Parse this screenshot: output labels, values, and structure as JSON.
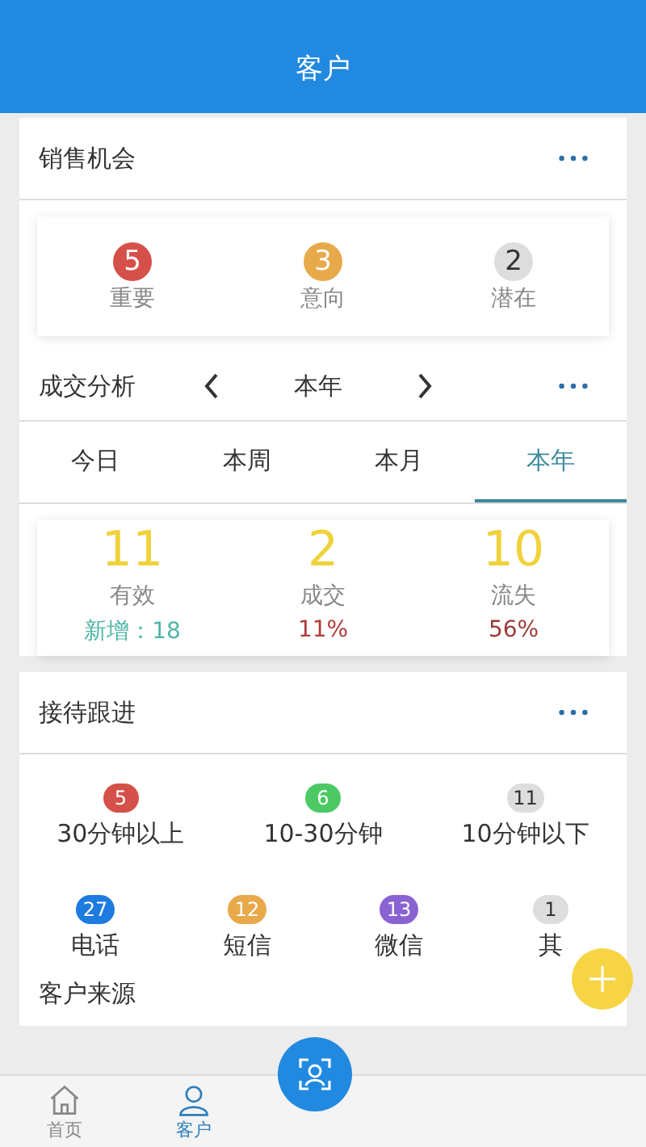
{
  "header": {
    "title": "客户"
  },
  "sales": {
    "title": "销售机会",
    "items": [
      {
        "count": "5",
        "label": "重要",
        "color": "#d6504a"
      },
      {
        "count": "3",
        "label": "意向",
        "color": "#e8a94a"
      },
      {
        "count": "2",
        "label": "潜在",
        "color": "#dddddd"
      }
    ]
  },
  "analysis": {
    "title": "成交分析",
    "period": "本年",
    "tabs": [
      {
        "label": "今日",
        "selected": false
      },
      {
        "label": "本周",
        "selected": false
      },
      {
        "label": "本月",
        "selected": false
      },
      {
        "label": "本年",
        "selected": true
      }
    ],
    "stats": [
      {
        "value": "11",
        "label": "有效",
        "sub": "新增：18",
        "color": "#4db6a8"
      },
      {
        "value": "2",
        "label": "成交",
        "sub": "11%",
        "color": "#b23a3a"
      },
      {
        "value": "10",
        "label": "流失",
        "sub": "56%",
        "color": "#9b3a3a"
      }
    ]
  },
  "follow_up": {
    "title": "接待跟进",
    "durations": [
      {
        "count": "5",
        "label": "30分钟以上",
        "color": "#d6504a"
      },
      {
        "count": "6",
        "label": "10-30分钟",
        "color": "#4cc964"
      },
      {
        "count": "11",
        "label": "10分钟以下",
        "color": "#dddddd"
      }
    ],
    "channels": [
      {
        "count": "27",
        "label": "电话",
        "color": "#1e7be0"
      },
      {
        "count": "12",
        "label": "短信",
        "color": "#e8a94a"
      },
      {
        "count": "13",
        "label": "微信",
        "color": "#8a63d2"
      },
      {
        "count": "1",
        "label": "其",
        "color": "#dddddd"
      }
    ]
  },
  "next_section": {
    "title": "客户来源"
  },
  "tab_bar": {
    "items": [
      {
        "label": "首页",
        "kind": "home",
        "selected": false
      },
      {
        "label": "客户",
        "kind": "person",
        "selected": true
      }
    ]
  }
}
